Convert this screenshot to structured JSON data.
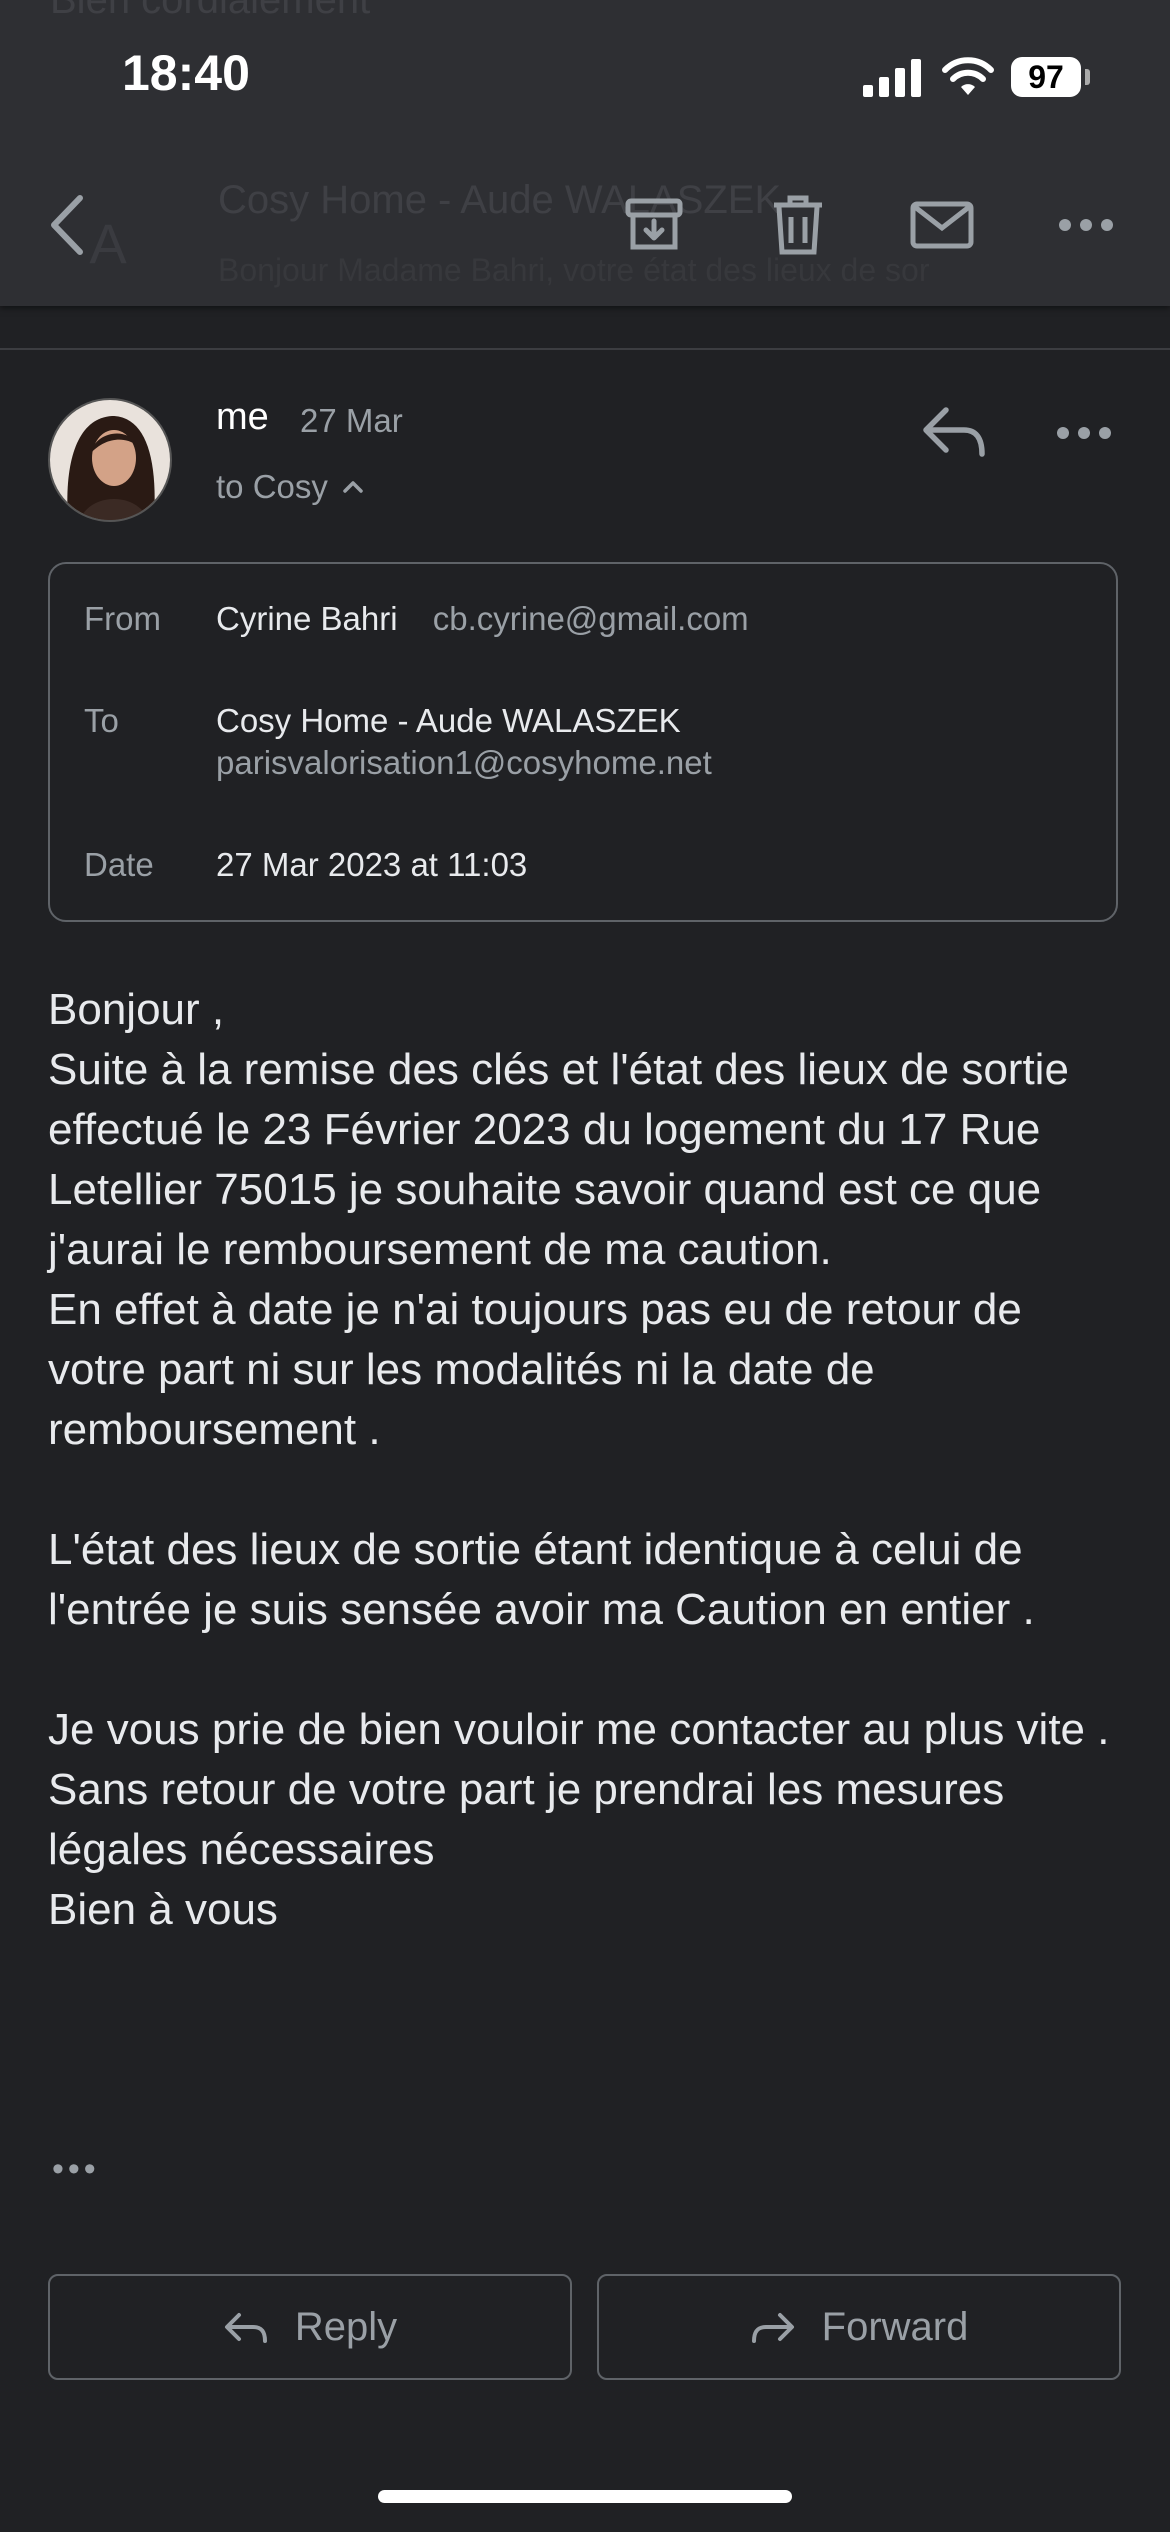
{
  "status_bar": {
    "time": "18:40",
    "battery": "97"
  },
  "background_list": {
    "top_text": "Bien cordialement",
    "title": "Cosy Home - Aude WALASZEK",
    "snippet": "Bonjour Madame Bahri, votre état des lieux de sor",
    "avatar_letter": "A"
  },
  "toolbar": {
    "back": "back-icon",
    "archive": "archive-icon",
    "delete": "trash-icon",
    "mark_unread": "mail-icon",
    "more": "more-horizontal-icon"
  },
  "message": {
    "sender": "me",
    "date": "27 Mar",
    "recipient_summary": "to Cosy"
  },
  "details": {
    "from_label": "From",
    "from_name": "Cyrine Bahri",
    "from_email": "cb.cyrine@gmail.com",
    "to_label": "To",
    "to_name": "Cosy Home - Aude WALASZEK",
    "to_email": "parisvalorisation1@cosyhome.net",
    "date_label": "Date",
    "date_value": "27 Mar 2023 at 11:03"
  },
  "body": "Bonjour ,\nSuite à la remise des clés et l'état des lieux de sortie  effectué le 23 Février 2023 du logement du 17 Rue Letellier 75015 je souhaite savoir quand est ce que j'aurai le remboursement de ma caution.\nEn effet à date je n'ai toujours pas eu de retour de votre part ni sur les modalités ni la date de remboursement .\n\nL'état des lieux de sortie étant identique à celui de l'entrée je suis sensée avoir ma Caution en entier .\n\nJe vous prie de bien vouloir me contacter au plus vite .\nSans retour de votre part je prendrai les mesures légales nécessaires\nBien à vous",
  "trimmed_indicator": "•••",
  "actions": {
    "reply": "Reply",
    "forward": "Forward"
  }
}
